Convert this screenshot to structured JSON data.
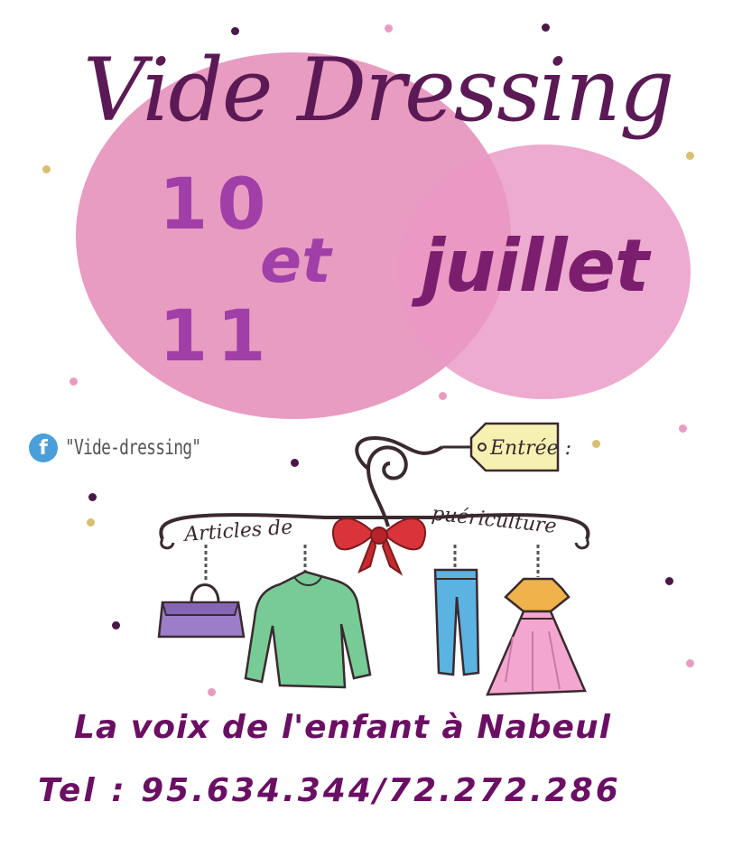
{
  "poster": {
    "title": "Vide Dressing",
    "date_first": "10",
    "date_conj": "et",
    "date_second": "11",
    "month": "juillet",
    "facebook": {
      "icon": "facebook-icon",
      "page_name": "\"Vide-dressing\""
    },
    "hanger_banner_left": "Articles de",
    "hanger_banner_right": "puériculture",
    "tag_label": "Entrée :",
    "organizer": "La voix de l'enfant à Nabeul",
    "phone": "Tel : 95.634.344/72.272.286"
  },
  "colors": {
    "title": "#5b1a55",
    "date": "#a13fa8",
    "month": "#7b1e6e",
    "circle_pink": "#e89cc2",
    "footer_text": "#6a0f63"
  }
}
